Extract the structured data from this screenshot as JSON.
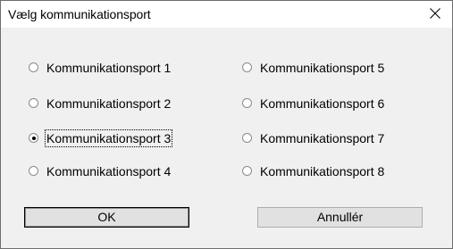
{
  "dialog": {
    "title": "Vælg kommunikationsport"
  },
  "options": [
    {
      "label": "Kommunikationsport 1",
      "selected": false
    },
    {
      "label": "Kommunikationsport 2",
      "selected": false
    },
    {
      "label": "Kommunikationsport 3",
      "selected": true
    },
    {
      "label": "Kommunikationsport 4",
      "selected": false
    },
    {
      "label": "Kommunikationsport 5",
      "selected": false
    },
    {
      "label": "Kommunikationsport 6",
      "selected": false
    },
    {
      "label": "Kommunikationsport 7",
      "selected": false
    },
    {
      "label": "Kommunikationsport 8",
      "selected": false
    }
  ],
  "buttons": {
    "ok_label": "OK",
    "cancel_label": "Annullér"
  },
  "icons": {
    "close": "close-icon"
  }
}
